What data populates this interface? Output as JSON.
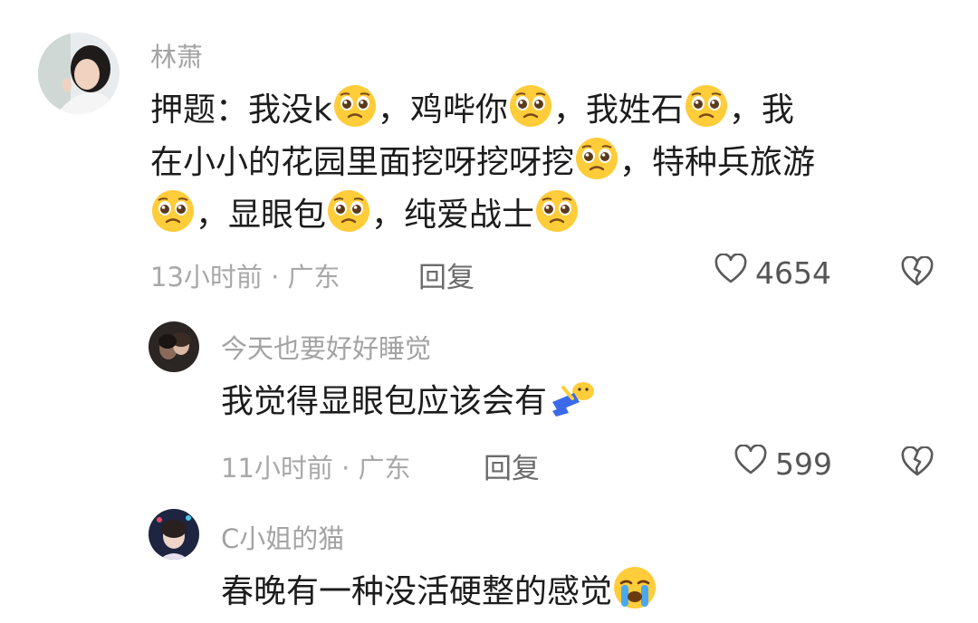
{
  "comments": [
    {
      "author": "林萧",
      "lines": [
        [
          "押题：我没k",
          "emoji:pleading",
          "，鸡哔你",
          "emoji:pleading",
          "，我姓石",
          "emoji:pleading",
          "，我"
        ],
        [
          "在小小的花园里面挖呀挖呀挖",
          "emoji:pleading",
          "，特种兵旅游"
        ],
        [
          "emoji:pleading",
          "，显眼包",
          "emoji:pleading",
          "，纯爱战士",
          "emoji:pleading"
        ]
      ],
      "time": "13小时前",
      "location": "广东",
      "meta_text": "13小时前 · 广东",
      "reply_label": "回复",
      "likes": "4654"
    },
    {
      "author": "今天也要好好睡觉",
      "lines": [
        [
          "我觉得显眼包应该会有",
          "emoji:lying-down"
        ]
      ],
      "time": "11小时前",
      "location": "广东",
      "meta_text": "11小时前 · 广东",
      "reply_label": "回复",
      "likes": "599"
    },
    {
      "author": "C小姐的猫",
      "lines": [
        [
          "春晚有一种没活硬整的感觉",
          "emoji:crying"
        ]
      ]
    }
  ],
  "icons": {
    "like": "heart-outline-icon",
    "dislike": "broken-heart-icon"
  },
  "colors": {
    "author": "#a3a3a3",
    "meta": "#a8a8a8",
    "text": "#1c1c1c",
    "emoji_face": "#ffcc3a"
  }
}
